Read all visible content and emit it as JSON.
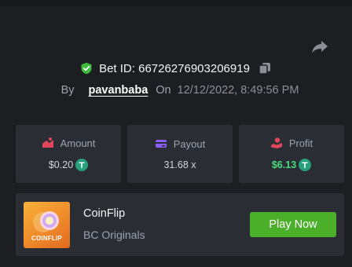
{
  "bet": {
    "id_label": "Bet ID: 66726276903206919",
    "by_label": "By",
    "username": "pavanbaba",
    "on_label": "On",
    "datetime": "12/12/2022, 8:49:56 PM"
  },
  "stats": {
    "amount": {
      "label": "Amount",
      "value": "$0.20",
      "icon": "bet-amount-icon"
    },
    "payout": {
      "label": "Payout",
      "value": "31.68 x",
      "icon": "wallet-card-icon"
    },
    "profit": {
      "label": "Profit",
      "value": "$6.13",
      "icon": "profit-hand-icon"
    }
  },
  "game": {
    "name": "CoinFlip",
    "provider": "BC Originals",
    "thumb_label": "COINFLIP",
    "play_label": "Play Now"
  },
  "colors": {
    "background": "#1c1e22",
    "card": "#2a2d33",
    "accent_green": "#4caf2a",
    "profit_green": "#4ade80",
    "amount_red": "#e0455a",
    "payout_purple": "#8b5cf6",
    "tether": "#26a17b"
  },
  "icons": [
    "share-icon",
    "verified-shield-icon",
    "copy-icon",
    "tether-icon"
  ]
}
